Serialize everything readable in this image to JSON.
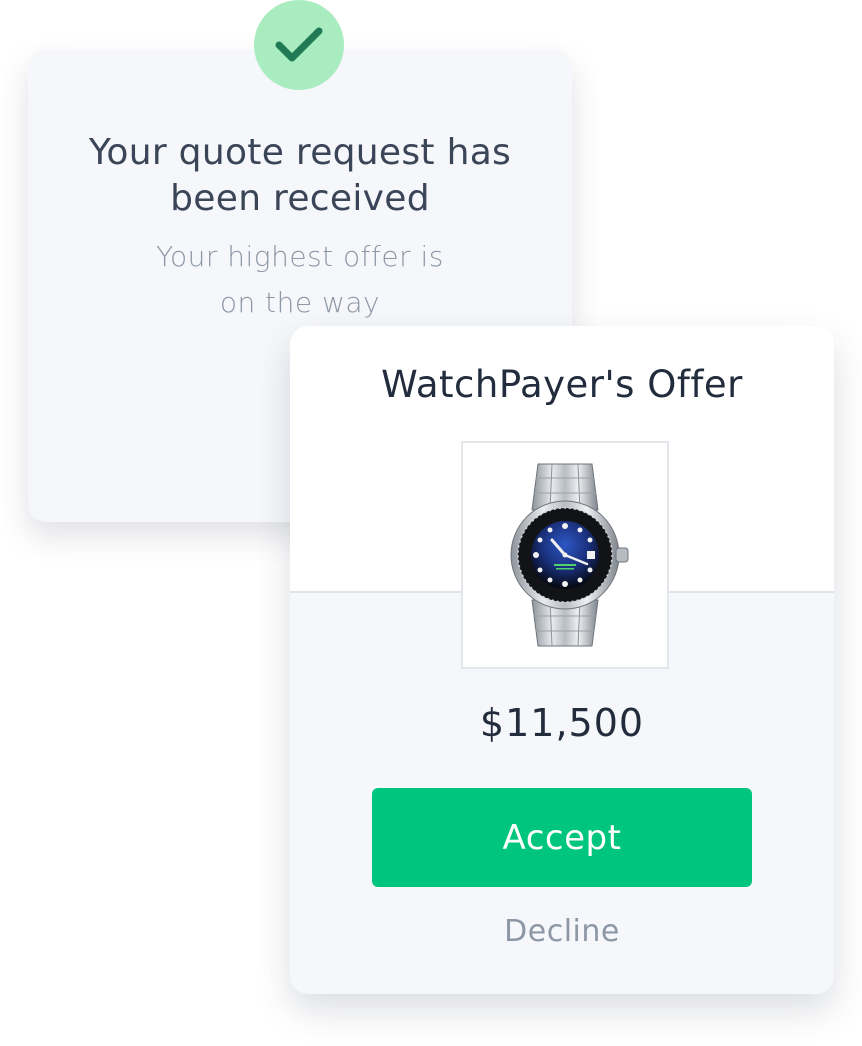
{
  "quote_card": {
    "title_line1": "Your quote request has",
    "title_line2": "been received",
    "subtitle_line1": "Your highest offer is",
    "subtitle_line2": "on the way",
    "badge_icon": "checkmark-icon",
    "badge_color": "#a8ecbf",
    "check_color": "#1f7a55"
  },
  "offer_card": {
    "title": "WatchPayer's Offer",
    "product_icon": "wristwatch-image",
    "price": "$11,500",
    "accept_label": "Accept",
    "decline_label": "Decline",
    "accent_color": "#00c57f"
  }
}
